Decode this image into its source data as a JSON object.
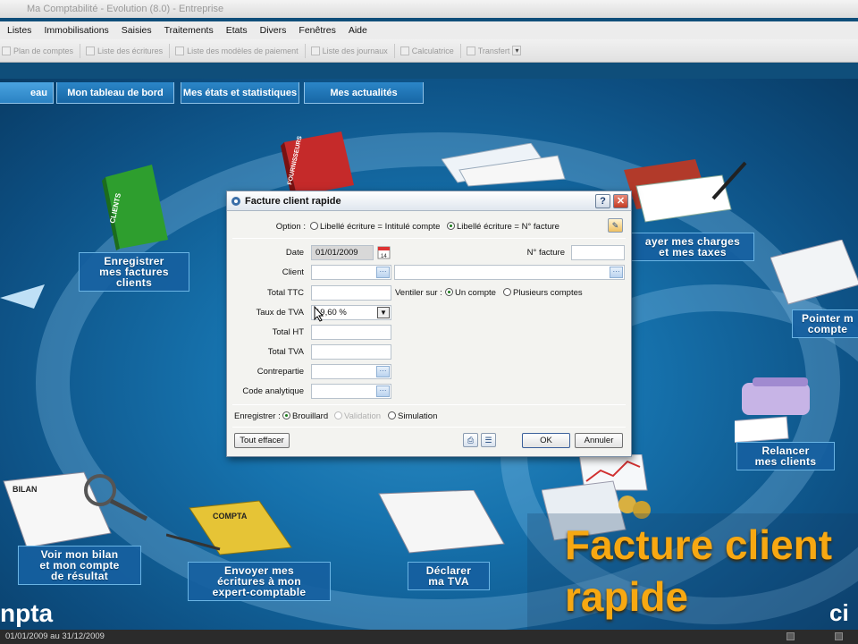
{
  "window": {
    "title": "Ma Comptabilité - Evolution (8.0) - Entreprise"
  },
  "menu": [
    "Listes",
    "Immobilisations",
    "Saisies",
    "Traitements",
    "Etats",
    "Divers",
    "Fenêtres",
    "Aide"
  ],
  "toolbar": [
    "Plan de comptes",
    "Liste des écritures",
    "Liste des modèles de paiement",
    "Liste des journaux",
    "Calculatrice",
    "Transfert"
  ],
  "nav_tabs": {
    "active": "eau",
    "items": [
      "Mon tableau de bord",
      "Mes états et statistiques",
      "Mes actualités"
    ]
  },
  "labels": {
    "enregistrer": [
      "Enregistrer",
      "mes factures",
      "clients"
    ],
    "payer": [
      "ayer mes charges",
      "et mes taxes"
    ],
    "pointer": [
      "Pointer m",
      "compte"
    ],
    "relancer": [
      "Relancer",
      "mes clients"
    ],
    "bilan": [
      "Voir mon bilan",
      "et mon compte",
      "de résultat"
    ],
    "envoyer": [
      "Envoyer mes",
      "écritures à mon",
      "expert-comptable"
    ],
    "declarer": [
      "Déclarer",
      "ma TVA"
    ]
  },
  "art": {
    "binder_green": "CLIENTS",
    "book_red": "FOURNISSEURS",
    "bilan_doc": "BILAN",
    "compta_folder": "COMPTA"
  },
  "caption": {
    "line1": "Facture client",
    "line2": "rapide"
  },
  "brand": {
    "left": "npta",
    "right": "ci"
  },
  "statusbar": {
    "period": "01/01/2009 au 31/12/2009"
  },
  "dialog": {
    "title": "Facture client rapide",
    "option_label": "Option :",
    "option_1": "Libellé écriture = Intitulé compte",
    "option_2": "Libellé écriture = N° facture",
    "option_selected": 2,
    "date_label": "Date",
    "date_value": "01/01/2009",
    "facture_label": "N° facture",
    "facture_value": "",
    "client_label": "Client",
    "client_value": "",
    "ttc_label": "Total TTC",
    "ttc_value": "",
    "ventiler_label": "Ventiler sur :",
    "ventiler_1": "Un compte",
    "ventiler_2": "Plusieurs comptes",
    "ventiler_selected": 1,
    "tva_label": "Taux de TVA",
    "tva_value": "19,60 %",
    "ht_label": "Total HT",
    "ht_value": "",
    "tvatotal_label": "Total TVA",
    "tvatotal_value": "",
    "contrepartie_label": "Contrepartie",
    "contrepartie_value": "",
    "analytique_label": "Code analytique",
    "analytique_value": "",
    "enregistrer_label": "Enregistrer :",
    "save_1": "Brouillard",
    "save_2": "Validation",
    "save_3": "Simulation",
    "save_selected": 1,
    "clear_button": "Tout effacer",
    "ok_button": "OK",
    "cancel_button": "Annuler"
  }
}
